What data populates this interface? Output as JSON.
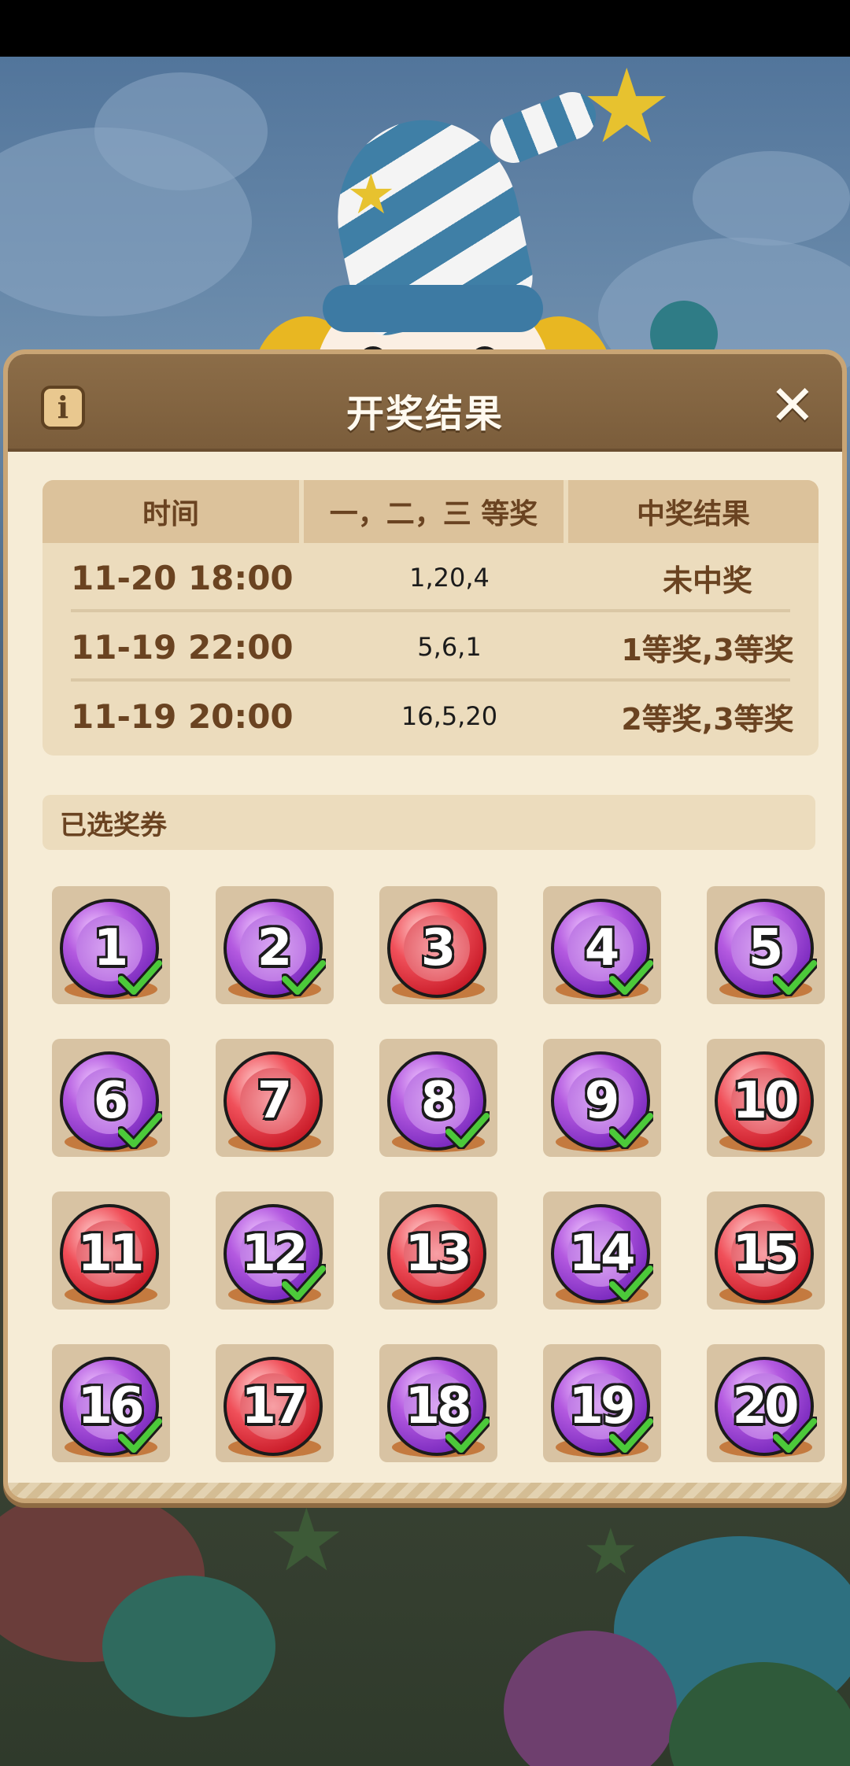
{
  "dialog": {
    "title": "开奖结果",
    "info_label": "i",
    "close_label": "✕"
  },
  "results": {
    "headers": [
      "时间",
      "一，二，三 等奖",
      "中奖结果"
    ],
    "rows": [
      {
        "time": "11-20 18:00",
        "numbers": "1,20,4",
        "result": "未中奖"
      },
      {
        "time": "11-19 22:00",
        "numbers": "5,6,1",
        "result": "1等奖,3等奖"
      },
      {
        "time": "11-19 20:00",
        "numbers": "16,5,20",
        "result": "2等奖,3等奖"
      }
    ]
  },
  "selected": {
    "header": "已选奖券",
    "tickets": [
      {
        "number": "1",
        "color": "purple",
        "checked": true
      },
      {
        "number": "2",
        "color": "purple",
        "checked": true
      },
      {
        "number": "3",
        "color": "red",
        "checked": false
      },
      {
        "number": "4",
        "color": "purple",
        "checked": true
      },
      {
        "number": "5",
        "color": "purple",
        "checked": true
      },
      {
        "number": "6",
        "color": "purple",
        "checked": true
      },
      {
        "number": "7",
        "color": "red",
        "checked": false
      },
      {
        "number": "8",
        "color": "purple",
        "checked": true
      },
      {
        "number": "9",
        "color": "purple",
        "checked": true
      },
      {
        "number": "10",
        "color": "red",
        "checked": false
      },
      {
        "number": "11",
        "color": "red",
        "checked": false
      },
      {
        "number": "12",
        "color": "purple",
        "checked": true
      },
      {
        "number": "13",
        "color": "red",
        "checked": false
      },
      {
        "number": "14",
        "color": "purple",
        "checked": true
      },
      {
        "number": "15",
        "color": "red",
        "checked": false
      },
      {
        "number": "16",
        "color": "purple",
        "checked": true
      },
      {
        "number": "17",
        "color": "red",
        "checked": false
      },
      {
        "number": "18",
        "color": "purple",
        "checked": true
      },
      {
        "number": "19",
        "color": "purple",
        "checked": true
      },
      {
        "number": "20",
        "color": "purple",
        "checked": true
      }
    ]
  },
  "colors": {
    "panel_header": "#7b5d3b",
    "panel_body": "#f6ecd6",
    "text_brown": "#6a4321",
    "check_green": "#4cc93a"
  },
  "icons": {
    "info": "info-icon",
    "close": "close-icon",
    "check": "check-icon"
  }
}
